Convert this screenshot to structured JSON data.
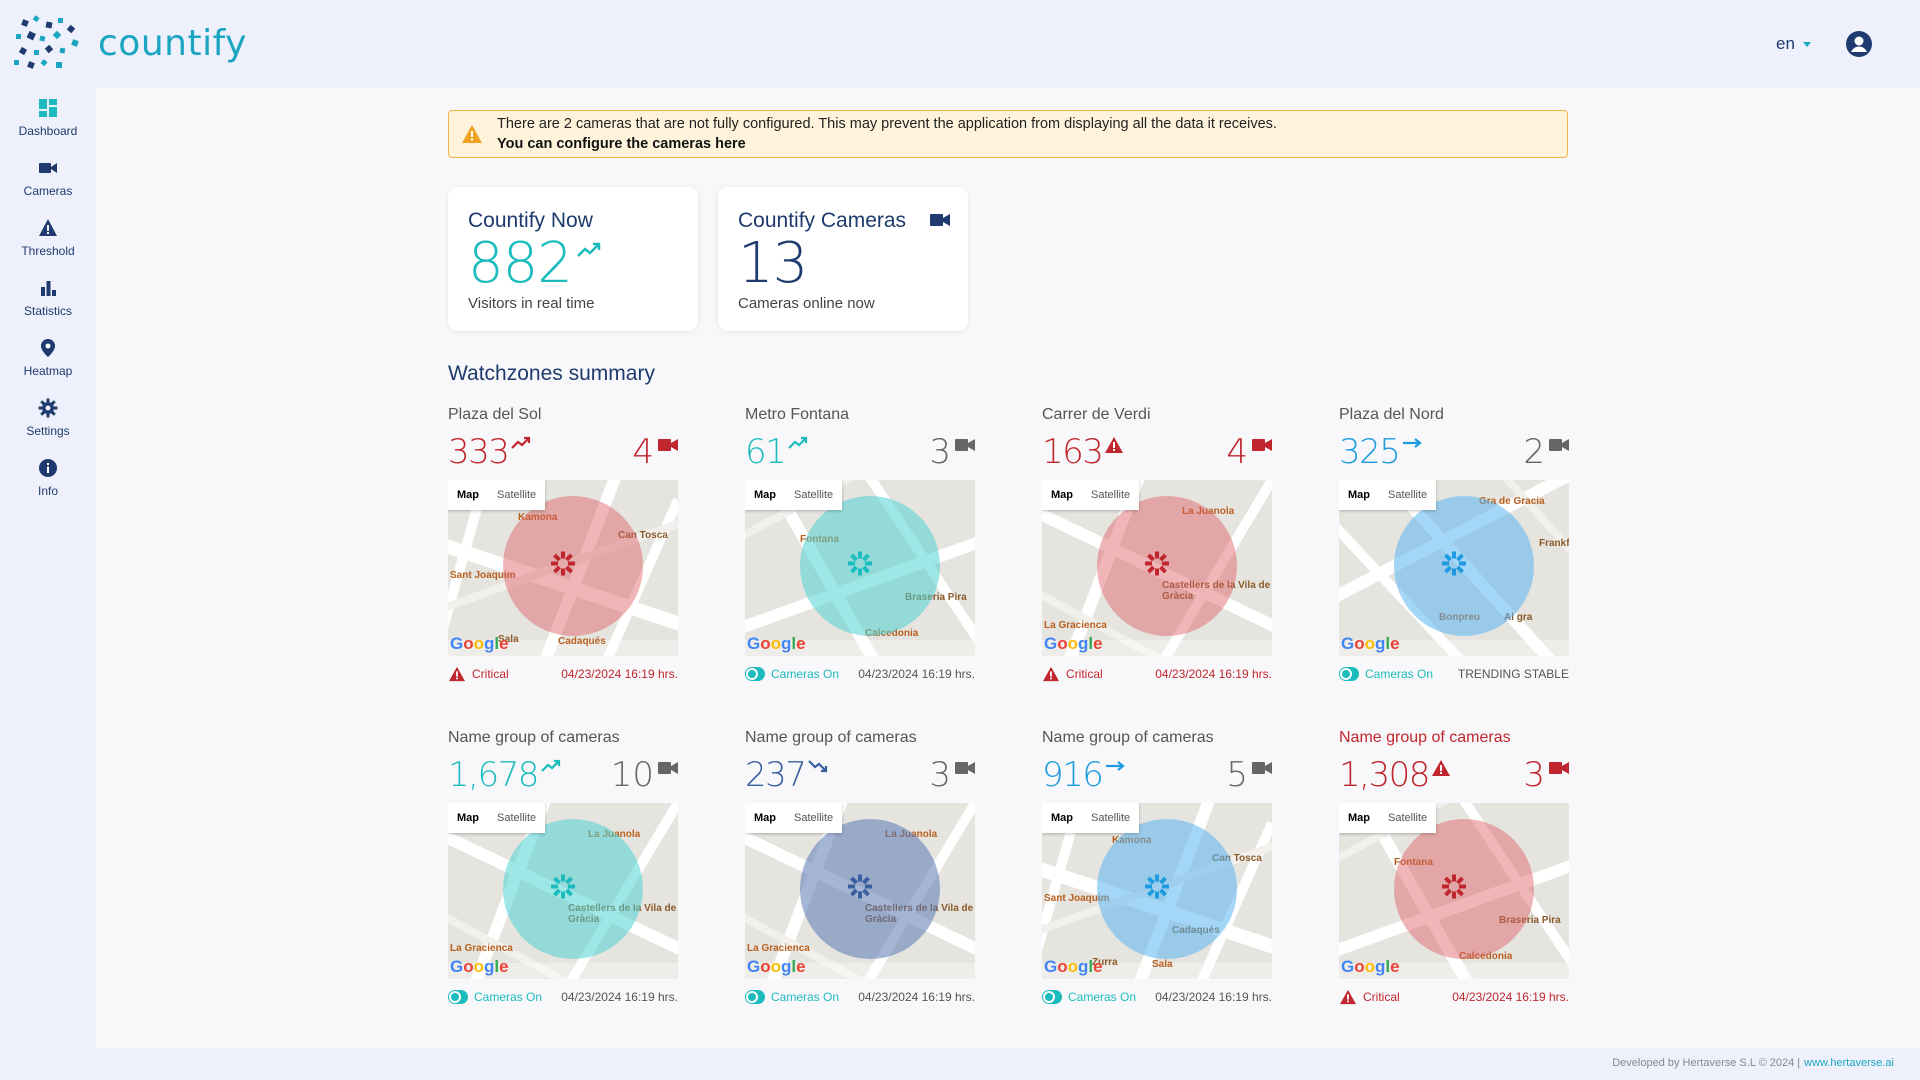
{
  "app": {
    "brand": "countify",
    "language": "en"
  },
  "colors": {
    "teal": "#1cbbbd",
    "red": "#c0262d",
    "blue": "#1e9be0",
    "navy": "#1e3a6e",
    "slate": "#3a5f9e",
    "amber": "#f0a020"
  },
  "sidebar": {
    "items": [
      {
        "label": "Dashboard",
        "icon": "dashboard-icon"
      },
      {
        "label": "Cameras",
        "icon": "camera-icon"
      },
      {
        "label": "Threshold",
        "icon": "warning-icon"
      },
      {
        "label": "Statistics",
        "icon": "bar-chart-icon"
      },
      {
        "label": "Heatmap",
        "icon": "location-pin-icon"
      },
      {
        "label": "Settings",
        "icon": "gear-icon"
      },
      {
        "label": "Info",
        "icon": "info-icon"
      }
    ]
  },
  "alert": {
    "message": "There are 2 cameras that are not fully configured. This may prevent the application from displaying all the data it receives.",
    "link": "You can configure the cameras here"
  },
  "cards": {
    "now": {
      "title": "Countify Now",
      "value": "882",
      "subtitle": "Visitors in real time"
    },
    "cameras": {
      "title": "Countify Cameras",
      "value": "13",
      "subtitle": "Cameras online now"
    }
  },
  "section_title": "Watchzones summary",
  "map_labels": {
    "map": "Map",
    "satellite": "Satellite",
    "google": "Google"
  },
  "zones": [
    {
      "name": "Plaza del Sol",
      "count": "333",
      "trend": "up",
      "cameras": "4",
      "status": "Critical",
      "right": "04/23/2024 16:19 hrs.",
      "tone": "red"
    },
    {
      "name": "Metro Fontana",
      "count": "61",
      "trend": "up",
      "cameras": "3",
      "status": "Cameras On",
      "right": "04/23/2024 16:19 hrs.",
      "tone": "teal"
    },
    {
      "name": "Carrer de Verdi",
      "count": "163",
      "trend": "alert",
      "cameras": "4",
      "status": "Critical",
      "right": "04/23/2024 16:19 hrs.",
      "tone": "red"
    },
    {
      "name": "Plaza del Nord",
      "count": "325",
      "trend": "flat",
      "cameras": "2",
      "status": "Cameras On",
      "right": "TRENDING STABLE",
      "tone": "blue"
    },
    {
      "name": "Name group of cameras",
      "count": "1,678",
      "trend": "up",
      "cameras": "10",
      "status": "Cameras On",
      "right": "04/23/2024 16:19 hrs.",
      "tone": "teal"
    },
    {
      "name": "Name group of cameras",
      "count": "237",
      "trend": "down",
      "cameras": "3",
      "status": "Cameras On",
      "right": "04/23/2024 16:19 hrs.",
      "tone": "slate"
    },
    {
      "name": "Name group of cameras",
      "count": "916",
      "trend": "flat",
      "cameras": "5",
      "status": "Cameras On",
      "right": "04/23/2024 16:19 hrs.",
      "tone": "blue"
    },
    {
      "name": "Name group of cameras",
      "count": "1,308",
      "trend": "alert",
      "cameras": "3",
      "status": "Critical",
      "right": "04/23/2024 16:19 hrs.",
      "tone": "red"
    }
  ],
  "zone_maps": [
    {
      "pois": [
        "Kamona",
        "Can Tosca",
        "Sant Joaquim",
        "Sala",
        "Cadaqués"
      ]
    },
    {
      "pois": [
        "Fontana",
        "Braseria Pira",
        "Calcedonia"
      ]
    },
    {
      "pois": [
        "La Juanola",
        "Castellers de la Vila de Gràcia",
        "La Gracienca"
      ]
    },
    {
      "pois": [
        "Gra de Gracia",
        "Frankfu",
        "Bonpreu",
        "Al gra"
      ]
    },
    {
      "pois": [
        "La Juanola",
        "Castellers de la Vila de Gràcia",
        "La Gracienca"
      ]
    },
    {
      "pois": [
        "La Juanola",
        "Castellers de la Vila de Gràcia",
        "La Gracienca"
      ]
    },
    {
      "pois": [
        "Kamona",
        "Can Tosca",
        "Sant Joaquim",
        "Zurra",
        "Sala",
        "Cadaqués"
      ]
    },
    {
      "pois": [
        "Fontana",
        "Braseria Pira",
        "Calcedonia"
      ]
    }
  ],
  "footer": {
    "text": "Developed by Hertaverse S.L © 2024 |",
    "link": "www.hertaverse.ai"
  }
}
